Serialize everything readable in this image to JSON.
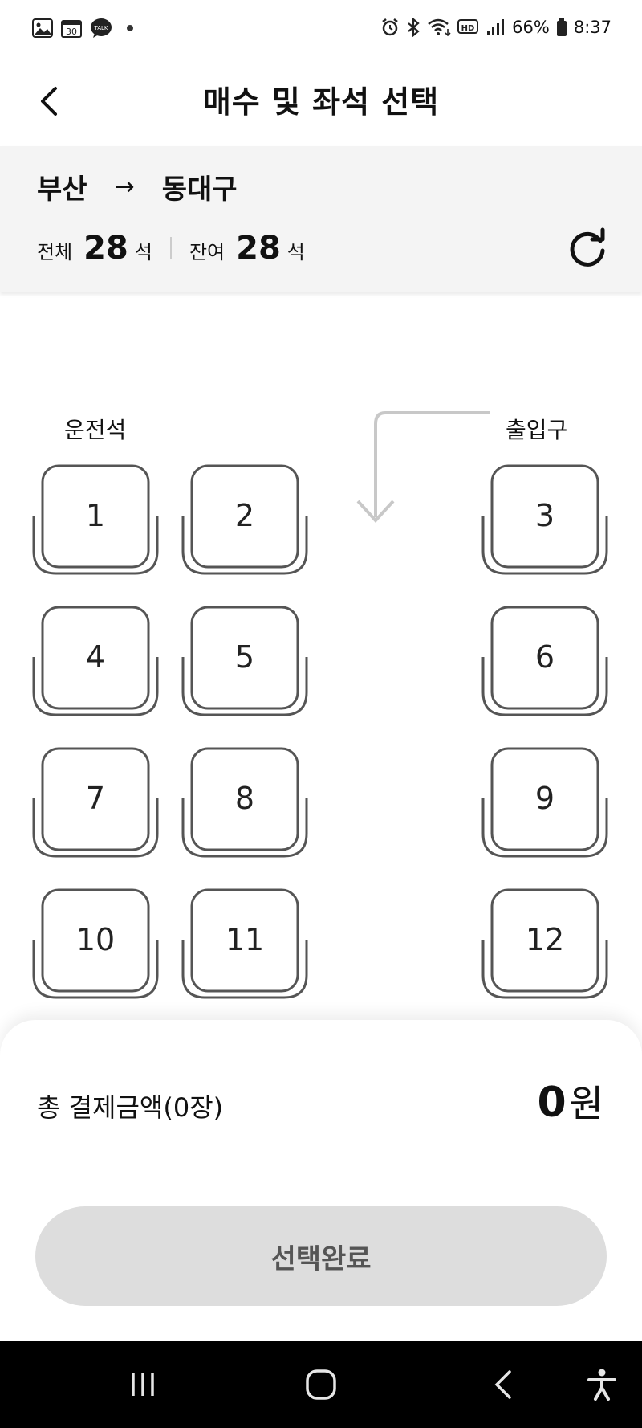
{
  "status_bar": {
    "battery": "66%",
    "time": "8:37"
  },
  "header": {
    "title": "매수 및 좌석 선택"
  },
  "route": {
    "origin": "부산",
    "arrow": "→",
    "destination": "동대구"
  },
  "counts": {
    "total_label": "전체",
    "total_value": "28",
    "remaining_label": "잔여",
    "remaining_value": "28",
    "unit": "석"
  },
  "seat_map": {
    "driver_label": "운전석",
    "entrance_label": "출입구",
    "seats": [
      "1",
      "2",
      "3",
      "4",
      "5",
      "6",
      "7",
      "8",
      "9",
      "10",
      "11",
      "12"
    ]
  },
  "summary": {
    "total_label": "총 결제금액(0장)",
    "amount": "0",
    "currency": "원"
  },
  "actions": {
    "complete_label": "선택완료"
  },
  "colors": {
    "panel_bg": "#f4f4f4",
    "seat_stroke": "#555555",
    "button_disabled": "#dddddd",
    "nav_bg": "#000000"
  },
  "icons": {
    "back": "chevron-left-icon",
    "refresh": "refresh-icon",
    "nav_recents": "recents-icon",
    "nav_home": "home-icon",
    "nav_back": "back-icon",
    "nav_accessibility": "accessibility-icon"
  }
}
